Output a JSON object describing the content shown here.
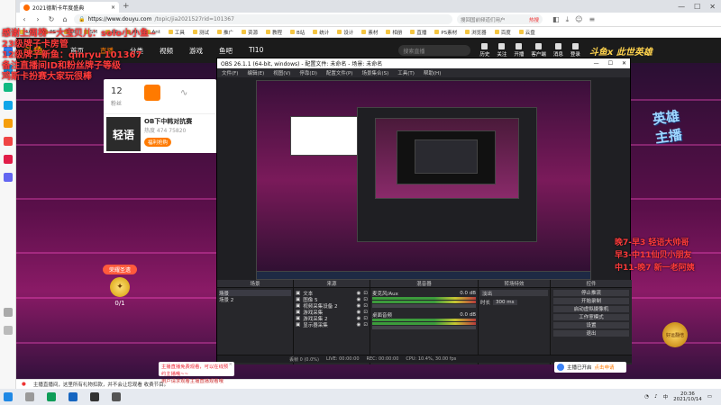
{
  "browser": {
    "tab_title": "2021德斯卡年度盛典",
    "url_host": "https://www.douyu.com",
    "url_path": "/topic/jia2021527rid=101367",
    "search_placeholder": "搜回国前频道们用户",
    "search_hot": "热搜",
    "bookmarks": [
      "LOL",
      "PS",
      "UI",
      "SM",
      "PR",
      "AI",
      "Ant",
      "工具",
      "测试",
      "推广",
      "资源",
      "教程",
      "B站",
      "统计",
      "设计",
      "素材",
      "相册",
      "直播",
      "PS素材",
      "浏览器",
      "百度",
      "云盘"
    ]
  },
  "site": {
    "logo": "斗鱼",
    "nav": [
      "首页",
      "直播",
      "分类",
      "视频",
      "游戏",
      "鱼吧",
      "TI10"
    ],
    "active_nav": "直播",
    "search_placeholder": "搜索直播",
    "actions": [
      "历史",
      "关注",
      "开播",
      "客户端",
      "消息",
      "登录"
    ],
    "banner": "斗鱼x 此世英雄"
  },
  "overlay": {
    "lines": [
      {
        "text": "感谢上周榜一大宝贝儿：solo小小鱼~",
        "color": "#ff3b3b"
      },
      {
        "text": "23级牌子卡房管",
        "color": "#ff3b3b"
      },
      {
        "text": "12级牌子新鱼：qinryu 101367",
        "color": "#ff3b3b"
      },
      {
        "text": "备注直播间ID和粉丝牌子等级",
        "color": "#ff3b3b"
      },
      {
        "text": "鸡斯卡扮赛大家玩很棒",
        "color": "#ff3b3b"
      }
    ],
    "schedule": [
      "晚7-早3 轻语大帅哥",
      "早3-中11仙贝小朋友",
      "中11-晚7 新一老阿姨"
    ],
    "schedule_color": "#ff3b3b"
  },
  "room_card": {
    "fans": "12",
    "fans_label": "粉丝",
    "promo_logo": "轻语",
    "promo_title": "OB下中韩对抗赛",
    "promo_sub": "热度 474 75820",
    "promo_btn": "福利抢购"
  },
  "gift": {
    "title": "荣耀圣遗",
    "count": "0/1"
  },
  "obs": {
    "title": "OBS 26.1.1 (64-bit, windows) - 配置文件: 未命名 - 场景: 未命名",
    "menu": [
      "文件(F)",
      "编辑(E)",
      "视图(V)",
      "停靠(D)",
      "配置文件(P)",
      "场景集合(S)",
      "工具(T)",
      "帮助(H)"
    ],
    "panels": {
      "scenes_title": "场景",
      "scenes": [
        "场景",
        "场景 2"
      ],
      "sources_title": "来源",
      "sources": [
        "文本",
        "图像 5",
        "视频采集设备 2",
        "游戏采集",
        "游戏采集 2",
        "显示器采集"
      ],
      "mixer_title": "混音器",
      "mixer": [
        {
          "name": "麦克风/Aux",
          "db": "0.0 dB"
        },
        {
          "name": "桌面音频",
          "db": "0.0 dB"
        }
      ],
      "transitions_title": "转场特效",
      "transition_type": "淡出",
      "duration_label": "时长",
      "duration": "300 ms",
      "controls_title": "控件",
      "controls": [
        "停止推流",
        "开始录制",
        "启动虚拟摄像机",
        "工作室模式",
        "设置",
        "退出"
      ]
    },
    "status": [
      "丢帧 0 (0.0%)",
      "LIVE: 00:00:00",
      "REC: 00:00:00",
      "CPU: 10.4%, 30.00 fps"
    ],
    "selected_scene": "场景"
  },
  "right": {
    "logo_text": "主播\n英雄",
    "badge": "好运翻倍"
  },
  "notices": {
    "popup": "主播直播免费观看，可以在线预约主播哦~~",
    "popup_sub": "用户请求观看主播直播观看哦",
    "right_promo": "主播已开启",
    "right_promo_link": "点击申请",
    "bottom_bar": "主播直播间，这里所有礼物扣款，并不会让您观看 收费节目。"
  },
  "taskbar": {
    "time": "20:36",
    "date": "2021/10/14",
    "lang": "中"
  },
  "colors": {
    "accent": "#ff7a00",
    "stream_bg": "#5b0f4a",
    "obs_bg": "#1f1f23"
  }
}
